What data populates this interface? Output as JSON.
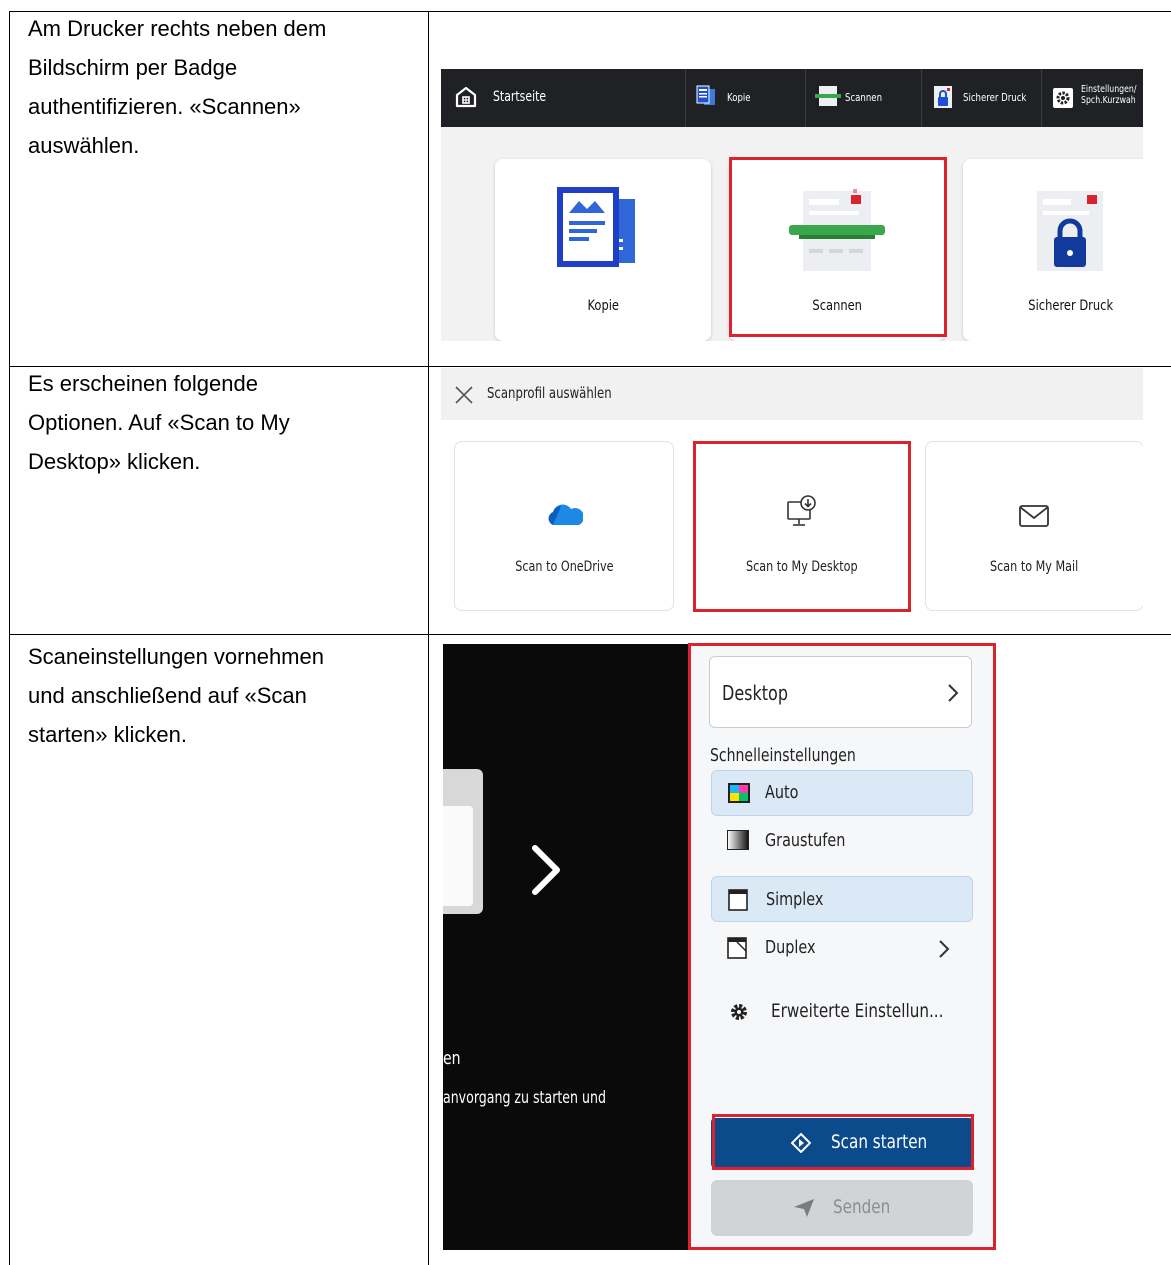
{
  "rows": [
    {
      "instruction_lines": [
        "Am Drucker rechts neben dem",
        "Bildschirm per Badge",
        "authentifizieren. «Scannen»",
        "auswählen."
      ],
      "screen": {
        "topbar": {
          "home": "Startseite",
          "items": [
            "Kopie",
            "Scannen",
            "Sicherer Druck",
            "Einstellungen/",
            "Spch.Kurzwah"
          ]
        },
        "tiles": [
          "Kopie",
          "Scannen",
          "Sicherer Druck"
        ]
      }
    },
    {
      "instruction_lines": [
        "Es erscheinen folgende",
        "Optionen. Auf «Scan to My",
        "Desktop» klicken."
      ],
      "screen": {
        "title": "Scanprofil auswählen",
        "cards": [
          "Scan to OneDrive",
          "Scan to My Desktop",
          "Scan to My Mail"
        ]
      }
    },
    {
      "instruction_lines": [
        "Scaneinstellungen vornehmen",
        "und anschließend auf «Scan",
        "starten» klicken."
      ],
      "screen": {
        "left_text_1": "en",
        "left_text_2": "anvorgang zu starten und",
        "destination": "Desktop",
        "section_title": "Schnelleinstellungen",
        "options": [
          "Auto",
          "Graustufen",
          "Simplex",
          "Duplex"
        ],
        "advanced": "Erweiterte Einstellun...",
        "start_button": "Scan starten",
        "send_button": "Senden"
      }
    }
  ],
  "colors": {
    "highlight": "#d9232e",
    "primary": "#0b4a8b",
    "accent_blue": "#1f4fd1"
  }
}
